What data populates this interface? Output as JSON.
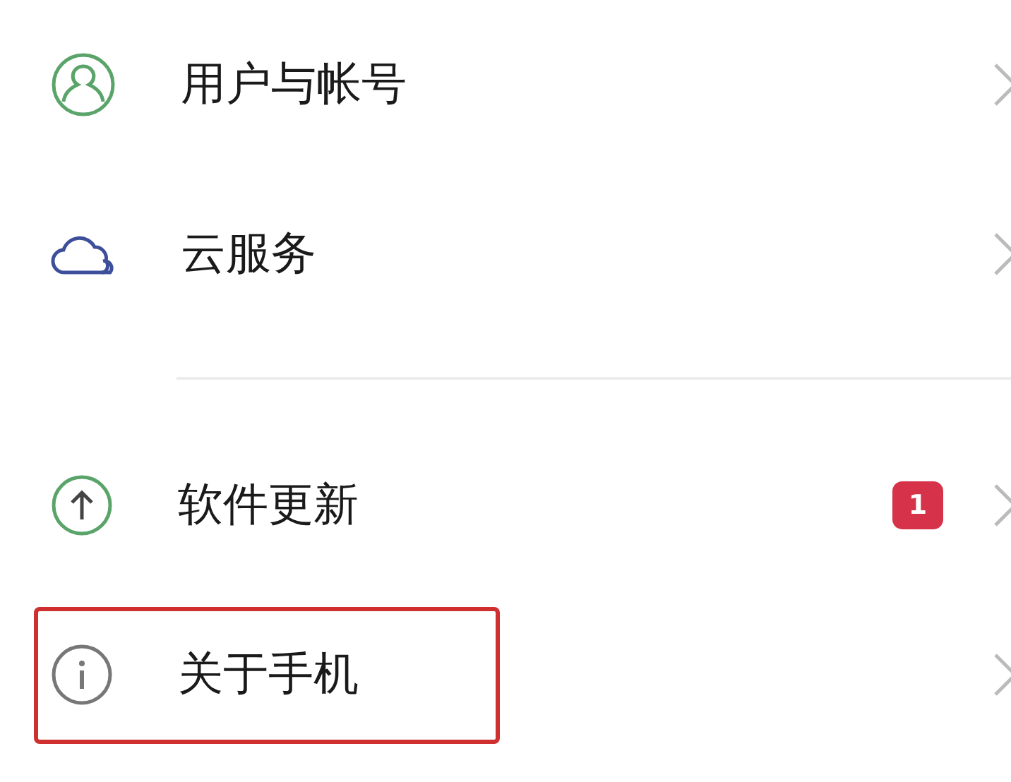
{
  "sections": [
    {
      "items": [
        {
          "kind": "user",
          "label": "用户与帐号",
          "highlighted": false
        },
        {
          "kind": "cloud",
          "label": "云服务",
          "highlighted": false
        }
      ]
    },
    {
      "items": [
        {
          "kind": "update",
          "label": "软件更新",
          "badge": "1",
          "highlighted": false
        },
        {
          "kind": "info",
          "label": "关于手机",
          "highlighted": true
        }
      ]
    }
  ]
}
